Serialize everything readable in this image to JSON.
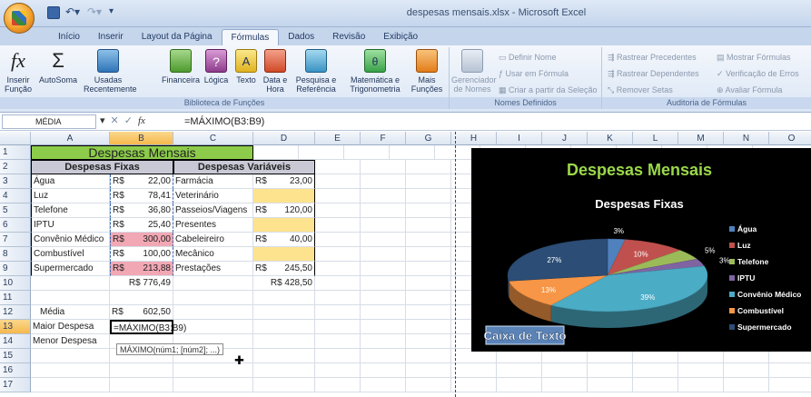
{
  "window": {
    "title": "despesas mensais.xlsx - Microsoft Excel"
  },
  "tabs": [
    "Início",
    "Inserir",
    "Layout da Página",
    "Fórmulas",
    "Dados",
    "Revisão",
    "Exibição"
  ],
  "ribbon": {
    "insert_function": "Inserir\nFunção",
    "autosum": "AutoSoma",
    "recent": "Usadas\nRecentemente",
    "financial": "Financeira",
    "logical": "Lógica",
    "text": "Texto",
    "datetime": "Data e\nHora",
    "lookup": "Pesquisa e\nReferência",
    "math": "Matemática e\nTrigonometria",
    "more": "Mais\nFunções",
    "library_label": "Biblioteca de Funções",
    "name_manager": "Gerenciador\nde Nomes",
    "define_name": "Definir Nome",
    "use_in_formula": "Usar em Fórmula",
    "create_from_selection": "Criar a partir da Seleção",
    "names_label": "Nomes Definidos",
    "trace_precedents": "Rastrear Precedentes",
    "trace_dependents": "Rastrear Dependentes",
    "remove_arrows": "Remover Setas",
    "show_formulas": "Mostrar Fórmulas",
    "error_checking": "Verificação de Erros",
    "evaluate_formula": "Avaliar Fórmula",
    "audit_label": "Auditoria de Fórmulas"
  },
  "formula_bar": {
    "name_box": "MÉDIA",
    "formula": "=MÁXIMO(B3:B9)"
  },
  "columns": [
    "A",
    "B",
    "C",
    "D",
    "E",
    "F",
    "G",
    "H",
    "I",
    "J",
    "K",
    "L",
    "M",
    "N",
    "O"
  ],
  "rows": [
    "1",
    "2",
    "3",
    "4",
    "5",
    "6",
    "7",
    "8",
    "9",
    "10",
    "11",
    "12",
    "13",
    "14",
    "15",
    "16",
    "17"
  ],
  "sheet": {
    "title": "Despesas Mensais",
    "fixed_header": "Despesas Fixas",
    "variable_header": "Despesas Variáveis",
    "fixed": [
      {
        "name": "Água",
        "cur": "R$",
        "val": "22,00"
      },
      {
        "name": "Luz",
        "cur": "R$",
        "val": "78,41"
      },
      {
        "name": "Telefone",
        "cur": "R$",
        "val": "36,80"
      },
      {
        "name": "IPTU",
        "cur": "R$",
        "val": "25,40"
      },
      {
        "name": "Convênio Médico",
        "cur": "R$",
        "val": "300,00"
      },
      {
        "name": "Combustível",
        "cur": "R$",
        "val": "100,00"
      },
      {
        "name": "Supermercado",
        "cur": "R$",
        "val": "213,88"
      }
    ],
    "variable": [
      {
        "name": "Farmácia",
        "cur": "R$",
        "val": "23,00"
      },
      {
        "name": "Veterinário",
        "cur": "",
        "val": ""
      },
      {
        "name": "Passeios/Viagens",
        "cur": "R$",
        "val": "120,00"
      },
      {
        "name": "Presentes",
        "cur": "",
        "val": ""
      },
      {
        "name": "Cabeleireiro",
        "cur": "R$",
        "val": "40,00"
      },
      {
        "name": "Mecânico",
        "cur": "",
        "val": ""
      },
      {
        "name": "Prestações",
        "cur": "R$",
        "val": "245,50"
      }
    ],
    "total_fixed": "R$ 776,49",
    "total_variable": "R$ 428,50",
    "media_label": "Média",
    "media_cur": "R$",
    "media_val": "602,50",
    "maior_label": "Maior Despesa",
    "maior_formula": "=MÁXIMO(B3:B9)",
    "menor_label": "Menor Despesa",
    "tooltip": "MÁXIMO(núm1; [núm2]; ...)"
  },
  "chart_data": {
    "type": "pie",
    "title": "Despesas Mensais",
    "subtitle": "Despesas Fixas",
    "textbox": "Caixa de Texto",
    "categories": [
      "Água",
      "Luz",
      "Telefone",
      "IPTU",
      "Convênio Médico",
      "Combustível",
      "Supermercado"
    ],
    "values": [
      22.0,
      78.41,
      36.8,
      25.4,
      300.0,
      100.0,
      213.88
    ],
    "labels": [
      "3%",
      "10%",
      "5%",
      "3%",
      "39%",
      "13%",
      "27%"
    ],
    "colors": [
      "#4f81bd",
      "#c0504d",
      "#9bbb59",
      "#8064a2",
      "#4bacc6",
      "#f79646",
      "#2c4d75"
    ],
    "legend": "right"
  }
}
